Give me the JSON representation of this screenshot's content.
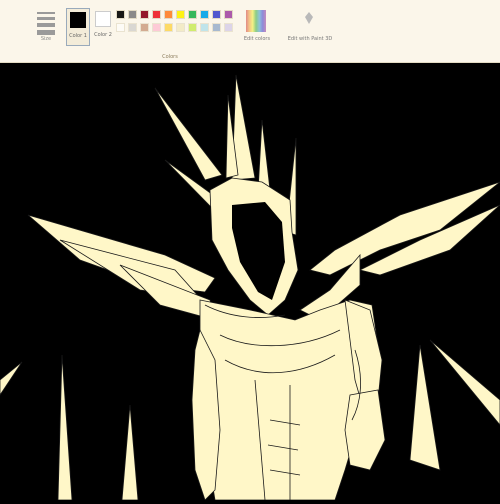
{
  "ribbon": {
    "size_label": "Size",
    "color1_label": "Color 1",
    "color2_label": "Color 2",
    "edit_colors_label": "Edit colors",
    "paint3d_label": "Edit with Paint 3D",
    "group_label": "Colors"
  },
  "colors": {
    "color1": "#000000",
    "color2": "#ffffff",
    "ribbon_bg": "#fbf6ea",
    "stroke": "#fff7c8"
  },
  "palette_row1": [
    "#000000",
    "#7f7f7f",
    "#880015",
    "#ed1c24",
    "#ff7f27",
    "#fff200",
    "#22b14c",
    "#00a2e8",
    "#3f48cc",
    "#a349a4"
  ],
  "palette_row2": [
    "#ffffff",
    "#c3c3c3",
    "#b97a57",
    "#ffaec9",
    "#ffc90e",
    "#efe4b0",
    "#b5e61d",
    "#99d9ea",
    "#7092be",
    "#c8bfe7"
  ],
  "icons": {
    "size": "size-lines-icon",
    "edit_colors": "rainbow-palette-icon",
    "paint3d": "paint3d-icon"
  }
}
